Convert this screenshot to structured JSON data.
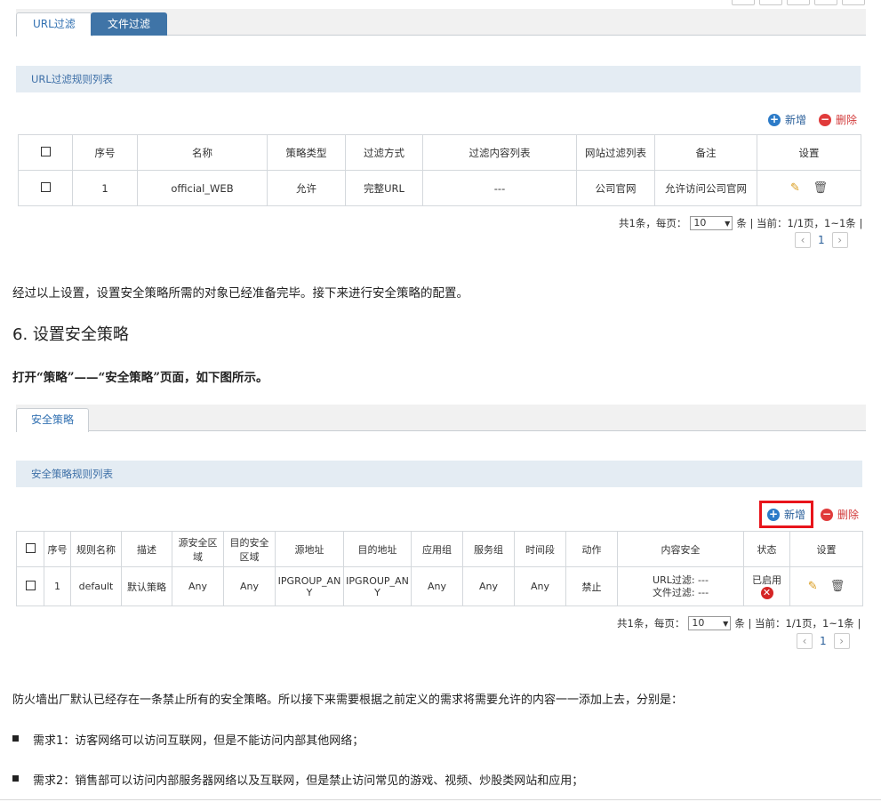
{
  "top_tabs": {
    "url_filter": "URL过滤",
    "file_filter": "文件过滤"
  },
  "url_section": {
    "title": "URL过滤规则列表",
    "add_label": "新增",
    "delete_label": "删除",
    "columns": [
      "序号",
      "名称",
      "策略类型",
      "过滤方式",
      "过滤内容列表",
      "网站过滤列表",
      "备注",
      "设置"
    ],
    "rows": [
      {
        "index": "1",
        "name": "official_WEB",
        "type": "允许",
        "method": "完整URL",
        "content_list": "---",
        "site_list": "公司官网",
        "remark": "允许访问公司官网"
      }
    ],
    "pager": {
      "total": "共1条，每页：",
      "per_page": "10",
      "tail": "条 | 当前：1/1页，1~1条 |",
      "page": "1"
    }
  },
  "text": {
    "para1": "经过以上设置，设置安全策略所需的对象已经准备完毕。接下来进行安全策略的配置。",
    "heading": "6. 设置安全策略",
    "para2": "打开“策略”——“安全策略”页面，如下图所示。",
    "para3": "防火墙出厂默认已经存在一条禁止所有的安全策略。所以接下来需要根据之前定义的需求将需要允许的内容一一添加上去，分别是：",
    "bullet1": "需求1：访客网络可以访问互联网，但是不能访问内部其他网络；",
    "bullet2": "需求2：销售部可以访问内部服务器网络以及互联网，但是禁止访问常见的游戏、视频、炒股类网站和应用；"
  },
  "policy_tabs": {
    "security_policy": "安全策略"
  },
  "policy_section": {
    "title": "安全策略规则列表",
    "add_label": "新增",
    "delete_label": "删除",
    "columns": [
      "序号",
      "规则名称",
      "描述",
      "源安全区域",
      "目的安全区域",
      "源地址",
      "目的地址",
      "应用组",
      "服务组",
      "时间段",
      "动作",
      "内容安全",
      "状态",
      "设置"
    ],
    "rows": [
      {
        "index": "1",
        "name": "default",
        "desc": "默认策略",
        "src_zone": "Any",
        "dst_zone": "Any",
        "src_addr": "IPGROUP_ANY",
        "dst_addr": "IPGROUP_ANY",
        "app": "Any",
        "service": "Any",
        "time": "Any",
        "action": "禁止",
        "url_filter": "URL过滤:  ---",
        "file_filter": "文件过滤:  ---",
        "status": "已启用"
      }
    ],
    "pager": {
      "total": "共1条，每页：",
      "per_page": "10",
      "tail": "条 | 当前：1/1页，1~1条 |",
      "page": "1"
    }
  },
  "colors": {
    "accent": "#3f74a7",
    "highlight": "#e8141b",
    "delete": "#e03b3b"
  }
}
